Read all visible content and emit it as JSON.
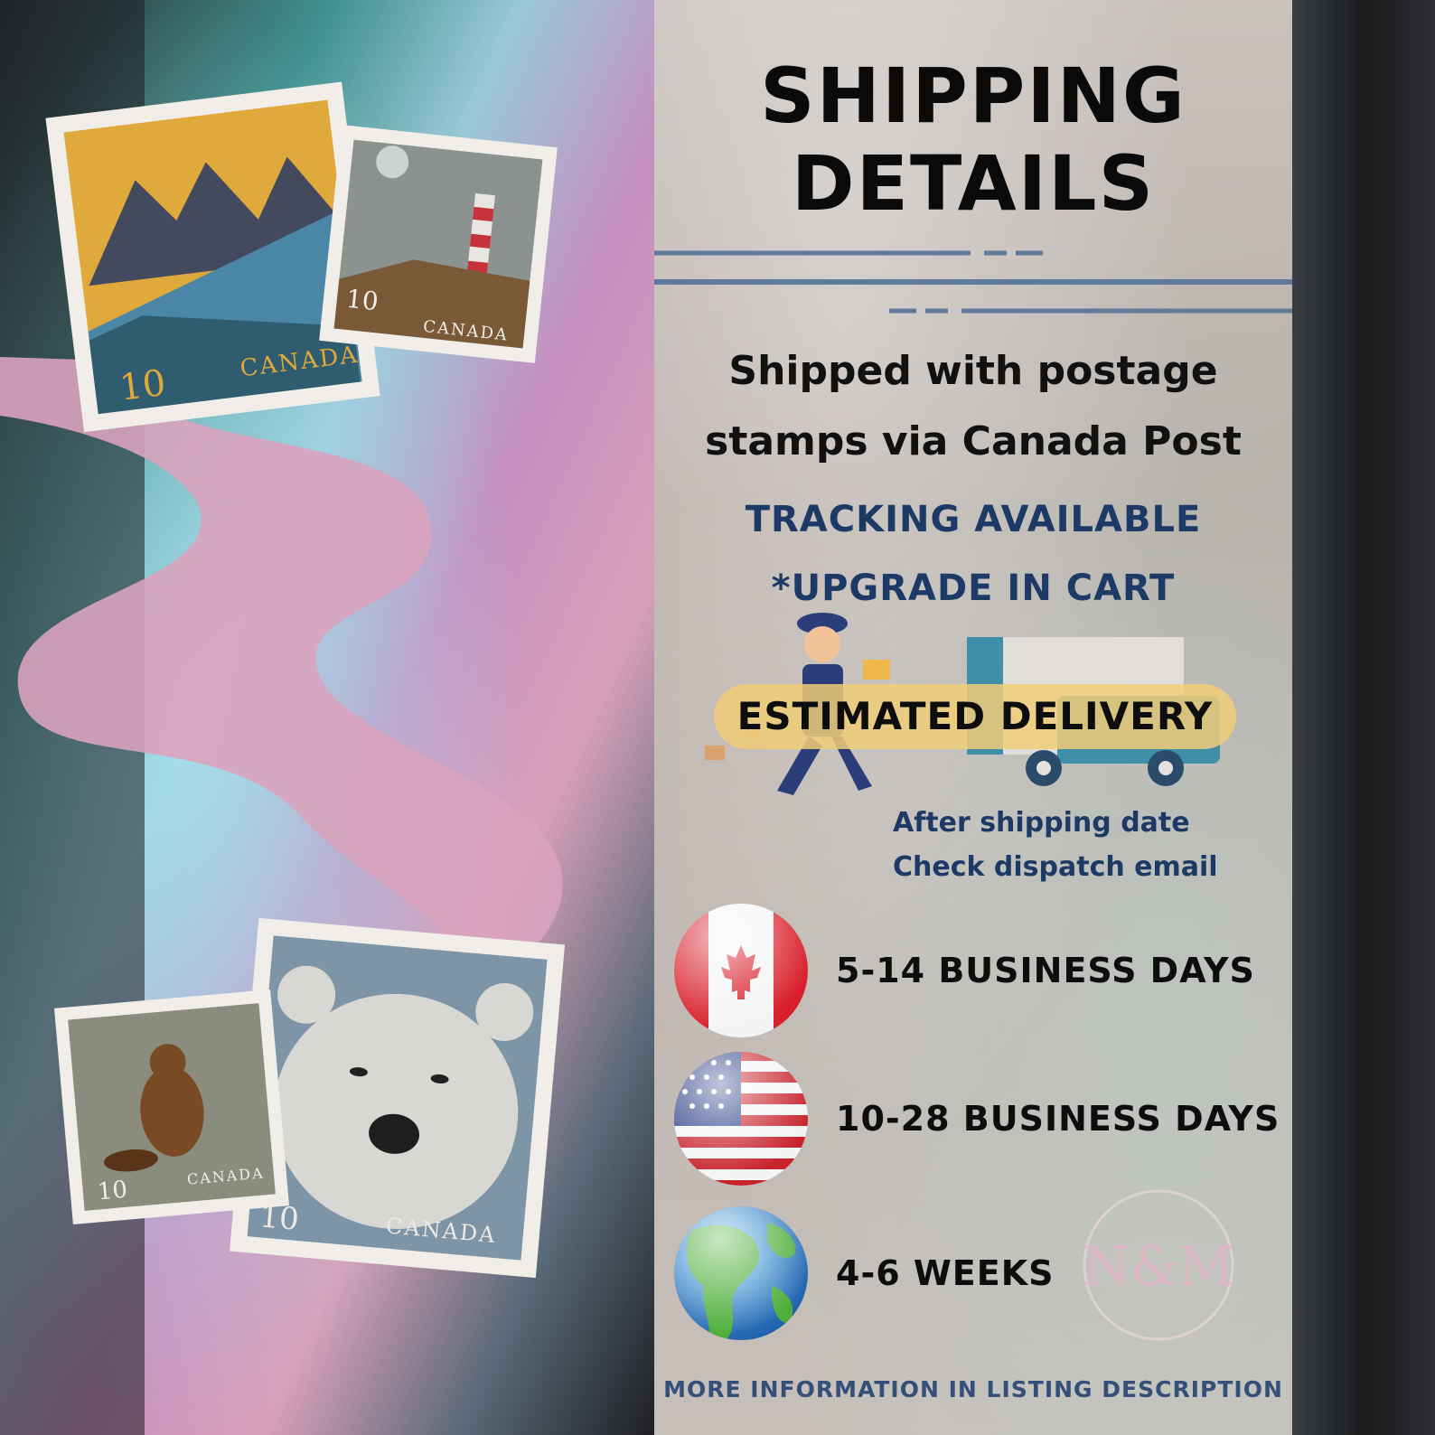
{
  "heading": {
    "line1": "SHIPPING",
    "line2": "DETAILS"
  },
  "method": {
    "line1": "Shipped with postage",
    "line2": "stamps via Canada Post"
  },
  "tracking": {
    "line1": "TRACKING AVAILABLE",
    "line2": "*UPGRADE IN CART"
  },
  "delivery": {
    "label": "ESTIMATED DELIVERY",
    "note1": "After shipping date",
    "note2": "Check dispatch email"
  },
  "regions": [
    {
      "flag": "canada-flag-icon",
      "time": "5-14 BUSINESS DAYS"
    },
    {
      "flag": "usa-flag-icon",
      "time": "10-28 BUSINESS DAYS"
    },
    {
      "flag": "globe-icon",
      "time": "4-6 WEEKS"
    }
  ],
  "footer": "MORE INFORMATION IN LISTING DESCRIPTION",
  "stamps": [
    {
      "name": "mountain-stamp",
      "value": "10",
      "country": "CANADA"
    },
    {
      "name": "lighthouse-stamp",
      "value": "10",
      "country": "CANADA"
    },
    {
      "name": "beaver-stamp",
      "value": "10",
      "country": "CANADA"
    },
    {
      "name": "polar-bear-stamp",
      "value": "10",
      "country": "CANADA"
    }
  ],
  "logo_text": "N&M",
  "colors": {
    "accent_blue": "#1d3a66",
    "pill": "#f0cd78",
    "ribbon": "#d9a3bd"
  }
}
